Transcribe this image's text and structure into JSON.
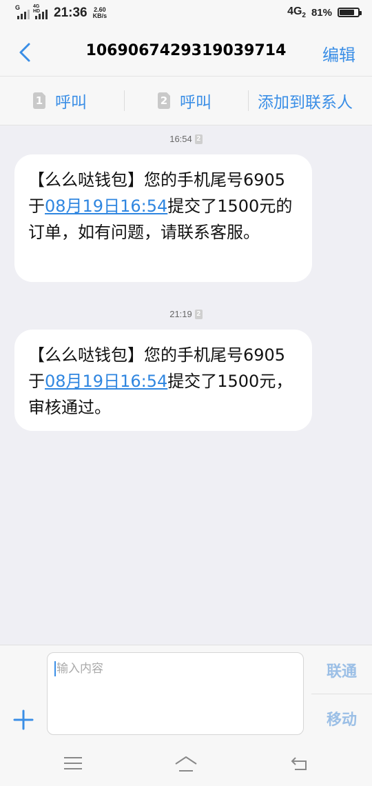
{
  "status_bar": {
    "sim1_label": "G",
    "sim2_label": "4G HD",
    "time": "21:36",
    "speed_value": "2.60",
    "speed_unit": "KB/s",
    "network": "4G",
    "network_sim": "2",
    "battery_text": "81%",
    "battery_level": 0.81
  },
  "header": {
    "title": "1069067429319039714",
    "edit_label": "编辑"
  },
  "actions": {
    "call1_sim": "1",
    "call1_label": "呼叫",
    "call2_sim": "2",
    "call2_label": "呼叫",
    "add_contact_label": "添加到联系人"
  },
  "messages": [
    {
      "time": "16:54",
      "sim": "2",
      "text_before": "【么么哒钱包】您的手机尾号6905于",
      "link": "08月19日16:54",
      "text_after": "提交了1500元的订单，如有问题，请联系客服。"
    },
    {
      "time": "21:19",
      "sim": "2",
      "text_before": "【么么哒钱包】您的手机尾号6905于",
      "link": "08月19日16:54",
      "text_after": "提交了1500元，审核通过。"
    }
  ],
  "composer": {
    "placeholder": "输入内容",
    "send_unicom": "联通",
    "send_mobile": "移动"
  },
  "colors": {
    "accent": "#3a8ee6",
    "background": "#efeff4",
    "bubble": "#ffffff"
  }
}
